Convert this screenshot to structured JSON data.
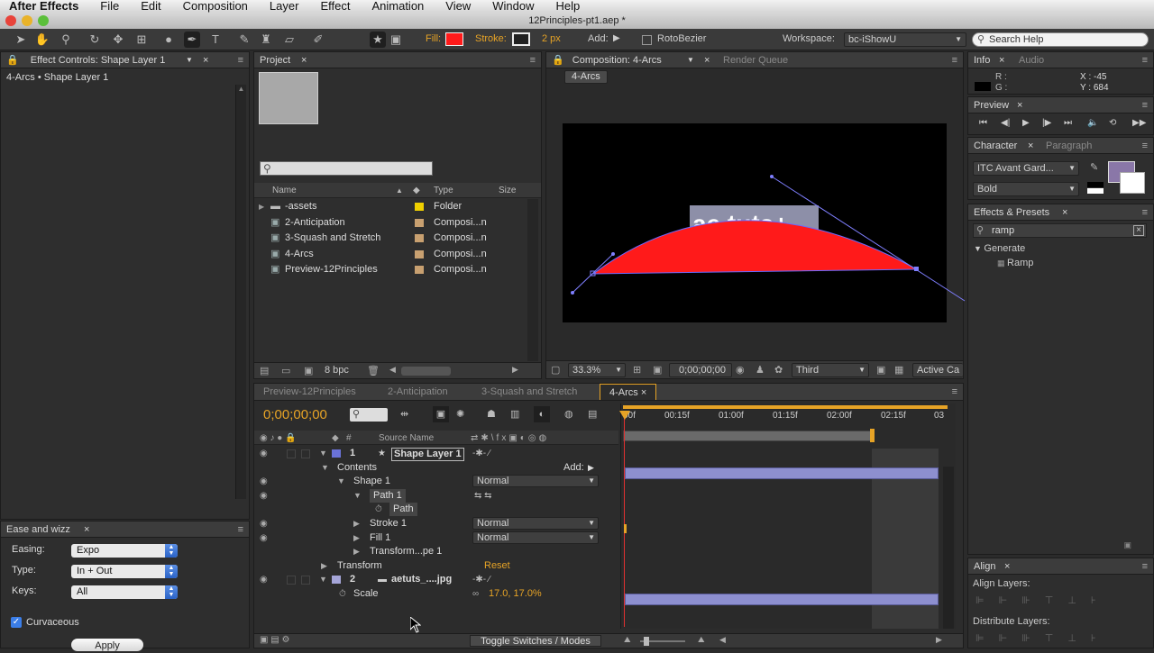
{
  "menubar": {
    "app": "After Effects",
    "items": [
      "File",
      "Edit",
      "Composition",
      "Layer",
      "Effect",
      "Animation",
      "View",
      "Window",
      "Help"
    ]
  },
  "window_title": "12Principles-pt1.aep *",
  "toolbar": {
    "fill_label": "Fill:",
    "stroke_label": "Stroke:",
    "stroke_width": "2 px",
    "add_label": "Add:",
    "rotobezier": "RotoBezier",
    "workspace_label": "Workspace:",
    "workspace_value": "bc-iShowU",
    "search_placeholder": "Search Help",
    "fill_color": "#ff1a1a",
    "accent": "#e6a326"
  },
  "effect_controls": {
    "tab": "Effect Controls: Shape Layer 1",
    "breadcrumb": "4-Arcs • Shape Layer 1"
  },
  "ease": {
    "tab": "Ease and wizz",
    "easing_label": "Easing:",
    "easing_value": "Expo",
    "type_label": "Type:",
    "type_value": "In + Out",
    "keys_label": "Keys:",
    "keys_value": "All",
    "curvaceous": "Curvaceous",
    "apply": "Apply"
  },
  "project": {
    "tab": "Project",
    "columns": {
      "name": "Name",
      "type": "Type",
      "size": "Size"
    },
    "items": [
      {
        "name": "-assets",
        "type": "Folder",
        "color": "#f0d000"
      },
      {
        "name": "2-Anticipation",
        "type": "Composi...n",
        "color": "#c8a070"
      },
      {
        "name": "3-Squash and Stretch",
        "type": "Composi...n",
        "color": "#c8a070"
      },
      {
        "name": "4-Arcs",
        "type": "Composi...n",
        "color": "#c8a070"
      },
      {
        "name": "Preview-12Principles",
        "type": "Composi...n",
        "color": "#c8a070"
      }
    ],
    "bpc": "8 bpc"
  },
  "composition": {
    "tab": "Composition: 4-Arcs",
    "tab2": "Render Queue",
    "chip": "4-Arcs",
    "logo_text": "ae tuts+",
    "zoom": "33.3%",
    "timecode": "0;00;00;00",
    "view": "Third",
    "camera": "Active Ca"
  },
  "info": {
    "tab": "Info",
    "tab2": "Audio",
    "r": "R :",
    "g": "G :",
    "x": "X : -45",
    "y": "Y : 684"
  },
  "preview": {
    "tab": "Preview"
  },
  "character": {
    "tab": "Character",
    "tab2": "Paragraph",
    "font": "ITC Avant Gard...",
    "style": "Bold",
    "swatch": "#8a77a8"
  },
  "effects": {
    "tab": "Effects & Presets",
    "search": "ramp",
    "group": "Generate",
    "item": "Ramp"
  },
  "align": {
    "tab": "Align",
    "layers": "Align Layers:",
    "distribute": "Distribute Layers:"
  },
  "timeline": {
    "tabs": [
      "Preview-12Principles",
      "2-Anticipation",
      "3-Squash and Stretch",
      "4-Arcs"
    ],
    "timecode": "0;00;00;00",
    "ruler": [
      "00f",
      "00:15f",
      "01:00f",
      "01:15f",
      "02:00f",
      "02:15f",
      "03"
    ],
    "col_source": "Source Name",
    "layers": [
      {
        "num": "1",
        "name": "Shape Layer 1"
      },
      {
        "label": "Contents",
        "add": "Add:"
      },
      {
        "label": "Shape 1",
        "mode": "Normal"
      },
      {
        "label": "Path 1"
      },
      {
        "label": "Path"
      },
      {
        "label": "Stroke 1",
        "mode": "Normal"
      },
      {
        "label": "Fill 1",
        "mode": "Normal"
      },
      {
        "label": "Transform...pe 1"
      },
      {
        "label": "Transform",
        "value": "Reset"
      },
      {
        "num": "2",
        "name": "aetuts_....jpg"
      },
      {
        "label": "Scale",
        "value": "17.0, 17.0%"
      }
    ],
    "toggle": "Toggle Switches / Modes"
  }
}
